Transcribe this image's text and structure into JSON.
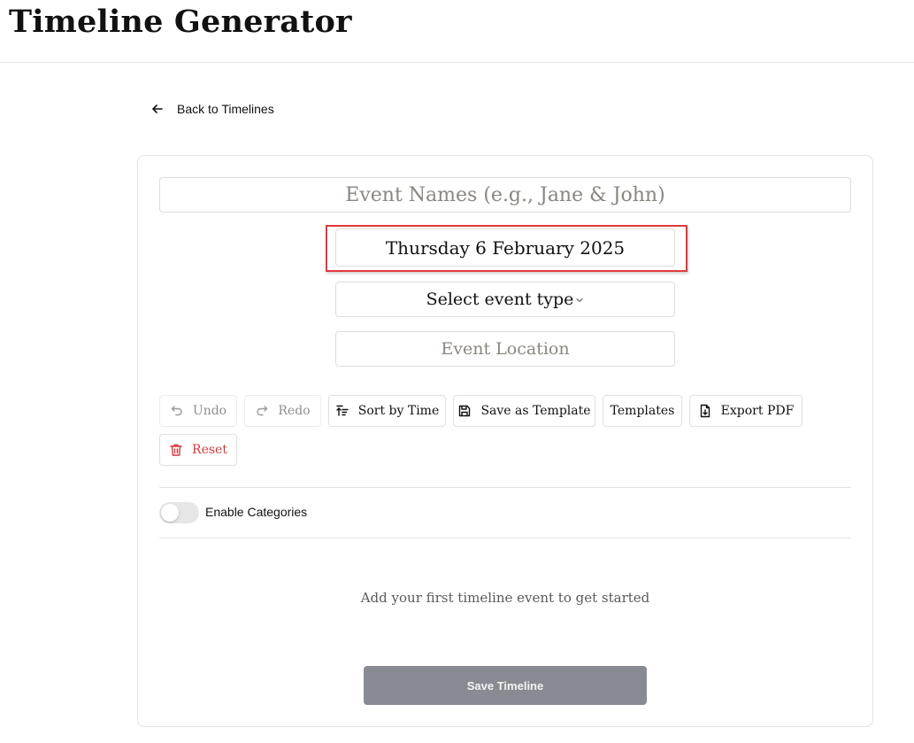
{
  "header": {
    "title": "Timeline Generator"
  },
  "nav": {
    "back_label": "Back to Timelines"
  },
  "form": {
    "event_names_placeholder": "Event Names (e.g., Jane & John)",
    "date_value": "Thursday 6 February 2025",
    "event_type_label": "Select event type",
    "location_placeholder": "Event Location"
  },
  "toolbar": {
    "undo_label": "Undo",
    "redo_label": "Redo",
    "sort_label": "Sort by Time",
    "save_template_label": "Save as Template",
    "templates_label": "Templates",
    "export_label": "Export PDF",
    "reset_label": "Reset"
  },
  "categories": {
    "label": "Enable Categories",
    "enabled": false
  },
  "timeline": {
    "empty_message": "Add your first timeline event to get started"
  },
  "footer": {
    "save_label": "Save Timeline"
  },
  "colors": {
    "danger": "#d7373c",
    "highlight": "#e0393e",
    "save_button": "#898b92",
    "placeholder": "#8a8680"
  },
  "icons": [
    "arrow-left-icon",
    "chevron-down-icon",
    "undo-icon",
    "redo-icon",
    "sort-icon",
    "save-icon",
    "file-download-icon",
    "trash-icon"
  ]
}
